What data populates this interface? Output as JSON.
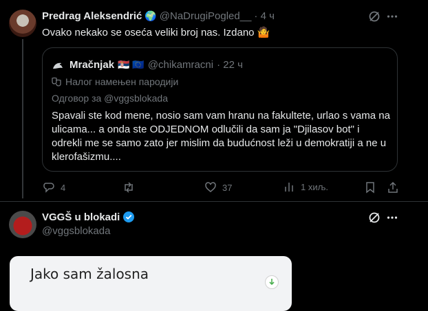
{
  "tweet1": {
    "name": "Predrag Aleksendrić",
    "badge_emoji": "🌍",
    "handle": "@NaDrugiPogled__",
    "time": "· 4 ч",
    "text": "Ovako nekako se oseća veliki broj nas. Izdano",
    "text_emoji": "🤷"
  },
  "quote": {
    "name": "Mračnjak",
    "flags": "🇷🇸 🇪🇺",
    "handle": "@chikamracni",
    "time": "· 22 ч",
    "label": "Налог намењен пародији",
    "reply_to": "Одговор за @vggsblokada",
    "text": "Spavali ste kod mene, nosio sam vam hranu na fakultete, urlao s vama na ulicama... a onda ste ODJEDNOM odlučili da sam ja \"Djilasov bot\" i odrekli me se samo zato jer mislim da budućnost leži u demokratiji a ne u klerofašizmu...."
  },
  "actions": {
    "replies": "4",
    "reposts": "",
    "likes": "37",
    "views": "1 хиљ."
  },
  "tweet2": {
    "name": "VGGŠ u blokadi",
    "handle": "@vggsblokada",
    "media_title": "Jako sam žalosna"
  },
  "colors": {
    "background": "#000000",
    "text": "#e7e9ea",
    "muted": "#71767b",
    "verified": "#1d9bf0",
    "border": "#2f3336"
  }
}
